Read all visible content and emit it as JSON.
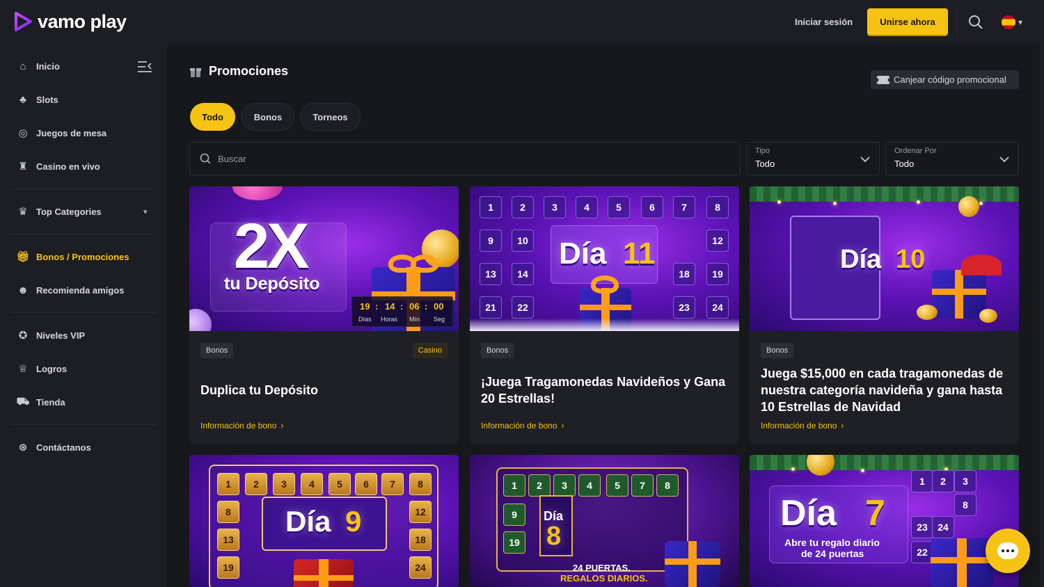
{
  "brand": {
    "name": "vamo play"
  },
  "header": {
    "login_label": "Iniciar sesión",
    "join_label": "Unirse ahora",
    "search_icon": "search-icon",
    "language_icon": "spain-flag-icon"
  },
  "sidebar": {
    "items": [
      {
        "label": "Inicio",
        "icon": "home-icon"
      },
      {
        "label": "Slots",
        "icon": "cherries-icon"
      },
      {
        "label": "Juegos de mesa",
        "icon": "chips-icon"
      },
      {
        "label": "Casino en vivo",
        "icon": "dealer-icon"
      },
      {
        "label": "Top Categories",
        "icon": "crown-icon"
      },
      {
        "label": "Bonos / Promociones",
        "icon": "gift-icon"
      },
      {
        "label": "Recomienda amigos",
        "icon": "users-icon"
      },
      {
        "label": "Niveles VIP",
        "icon": "medal-icon"
      },
      {
        "label": "Logros",
        "icon": "trophy-icon"
      },
      {
        "label": "Tienda",
        "icon": "cart-icon"
      },
      {
        "label": "Contáctanos",
        "icon": "support-24-icon"
      }
    ]
  },
  "page": {
    "title": "Promociones",
    "promo_code_label": "Canjear código promocional"
  },
  "filters": {
    "tabs": [
      "Todo",
      "Bonos",
      "Torneos"
    ],
    "active_tab": "Todo",
    "search_placeholder": "Buscar",
    "tipo": {
      "label": "Tipo",
      "value": "Todo"
    },
    "orden": {
      "label": "Ordenar Por",
      "value": "Todo"
    }
  },
  "cards": [
    {
      "badge": "Bonos",
      "badge2": "Casino",
      "title": "Duplica tu Depósito",
      "link": "Información de bono",
      "art_big": "2X",
      "art_sub": "tu Depósito",
      "countdown": {
        "dias": "19",
        "horas": "14",
        "min": "06",
        "seg": "00",
        "l_dias": "Días",
        "l_horas": "Horas",
        "l_min": "Mín",
        "l_seg": "Seg"
      }
    },
    {
      "badge": "Bonos",
      "title": "¡Juega Tragamonedas Navideños y Gana 20 Estrellas!",
      "link": "Información de bono",
      "art_day": "Día",
      "art_num": "11"
    },
    {
      "badge": "Bonos",
      "title": "Juega $15,000 en cada tragamonedas de nuestra categoría navideña y gana hasta 10 Estrellas de Navidad",
      "link": "Información de bono",
      "art_day": "Día",
      "art_num": "10"
    },
    {
      "art_day": "Día",
      "art_num": "9"
    },
    {
      "art_day": "Día",
      "art_num": "8",
      "art_caption1": "24 PUERTAS.",
      "art_caption2": "REGALOS DIARIOS."
    },
    {
      "art_day": "Día",
      "art_num": "7",
      "art_caption1": "Abre tu regalo diario",
      "art_caption2": "de 24 puertas"
    }
  ],
  "colors": {
    "accent": "#f7c313",
    "bg": "#17181c",
    "panel": "#1d1e23",
    "card": "#1f2025"
  }
}
